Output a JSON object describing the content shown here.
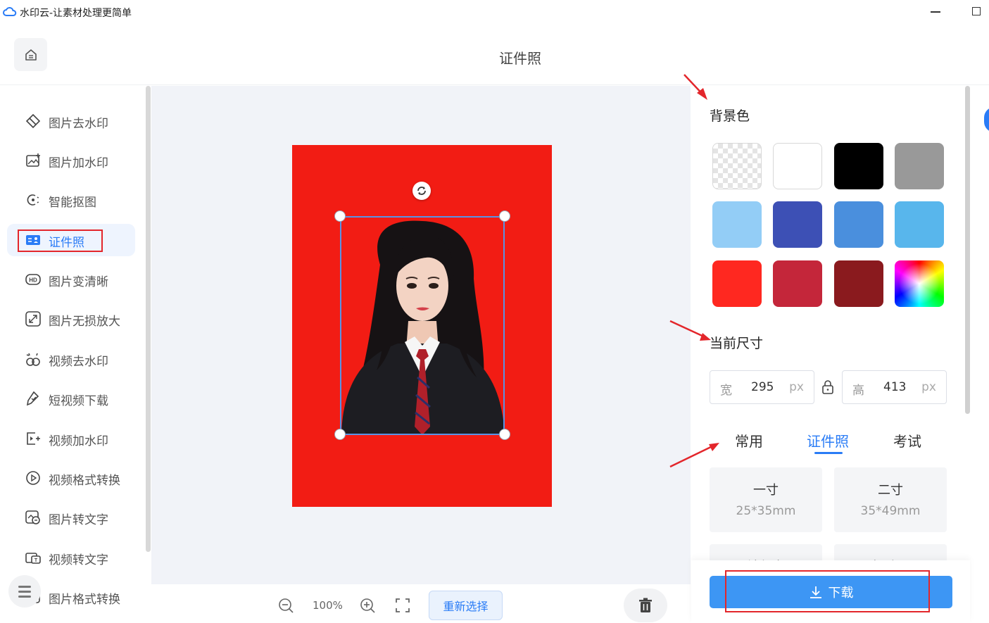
{
  "window": {
    "title": "水印云-让素材处理更简单",
    "logo_icon": "cloud-logo-icon"
  },
  "header": {
    "page_title": "证件照",
    "home_icon": "home-icon"
  },
  "sidebar": {
    "items": [
      {
        "label": "图片去水印",
        "icon": "eraser-icon"
      },
      {
        "label": "图片加水印",
        "icon": "image-add-icon"
      },
      {
        "label": "智能抠图",
        "icon": "cutout-icon"
      },
      {
        "label": "证件照",
        "icon": "id-card-icon",
        "active": true
      },
      {
        "label": "图片变清晰",
        "icon": "hd-icon"
      },
      {
        "label": "图片无损放大",
        "icon": "enlarge-icon"
      },
      {
        "label": "视频去水印",
        "icon": "video-clean-icon"
      },
      {
        "label": "短视频下载",
        "icon": "download-link-icon"
      },
      {
        "label": "视频加水印",
        "icon": "video-add-icon"
      },
      {
        "label": "视频格式转换",
        "icon": "play-circle-icon"
      },
      {
        "label": "图片转文字",
        "icon": "image-text-icon"
      },
      {
        "label": "视频转文字",
        "icon": "video-text-icon"
      },
      {
        "label": "图片格式转换",
        "icon": "format-icon"
      }
    ]
  },
  "canvas": {
    "photo_bg_color": "#f21c14",
    "zoom": "100%",
    "reselect_label": "重新选择"
  },
  "panel": {
    "bg_title": "背景色",
    "colors": [
      "transparent",
      "#ffffff",
      "#000000",
      "#999999",
      "#93cdf6",
      "#3d50b5",
      "#4a8fdd",
      "#58b6ec",
      "#ff2820",
      "#c4263a",
      "#8a1a1e",
      "rainbow"
    ],
    "size_title": "当前尺寸",
    "width_prefix": "宽",
    "width_value": "295",
    "height_prefix": "高",
    "height_value": "413",
    "unit": "px",
    "tabs": [
      "常用",
      "证件照",
      "考试"
    ],
    "active_tab": "证件照",
    "cards": [
      {
        "name": "一寸",
        "dim": "25*35mm"
      },
      {
        "name": "二寸",
        "dim": "35*49mm"
      },
      {
        "name": "社保卡",
        "dim": ""
      },
      {
        "name": "驾驶证",
        "dim": ""
      }
    ],
    "download_label": "下载"
  }
}
